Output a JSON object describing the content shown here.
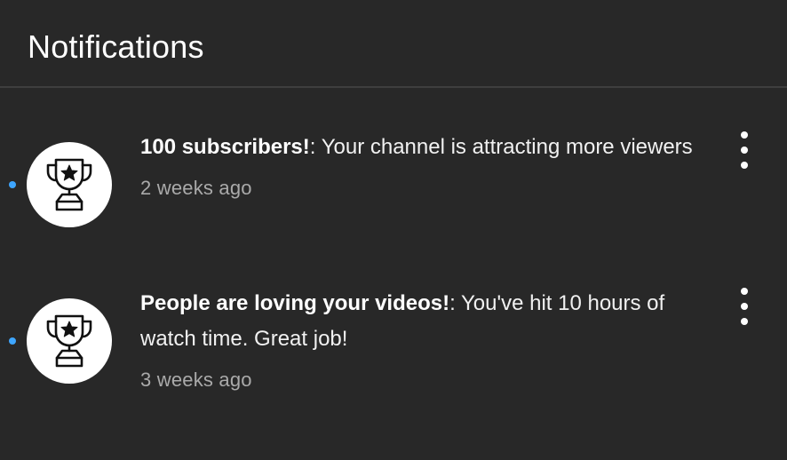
{
  "header": {
    "title": "Notifications"
  },
  "notifications": [
    {
      "title": "100 subscribers!",
      "separator": ":",
      "text": " Your channel is attracting more viewers",
      "time": "2 weeks ago",
      "icon": "trophy-star-icon",
      "unread": true
    },
    {
      "title": "People are loving your videos!",
      "separator": ":",
      "text": " You've hit 10 hours of watch time. Great job!",
      "time": "3 weeks ago",
      "icon": "trophy-star-icon",
      "unread": true
    }
  ],
  "colors": {
    "background": "#282828",
    "divider": "#3e3e3e",
    "unread_dot": "#3ea6ff",
    "secondary_text": "#aaaaaa"
  }
}
